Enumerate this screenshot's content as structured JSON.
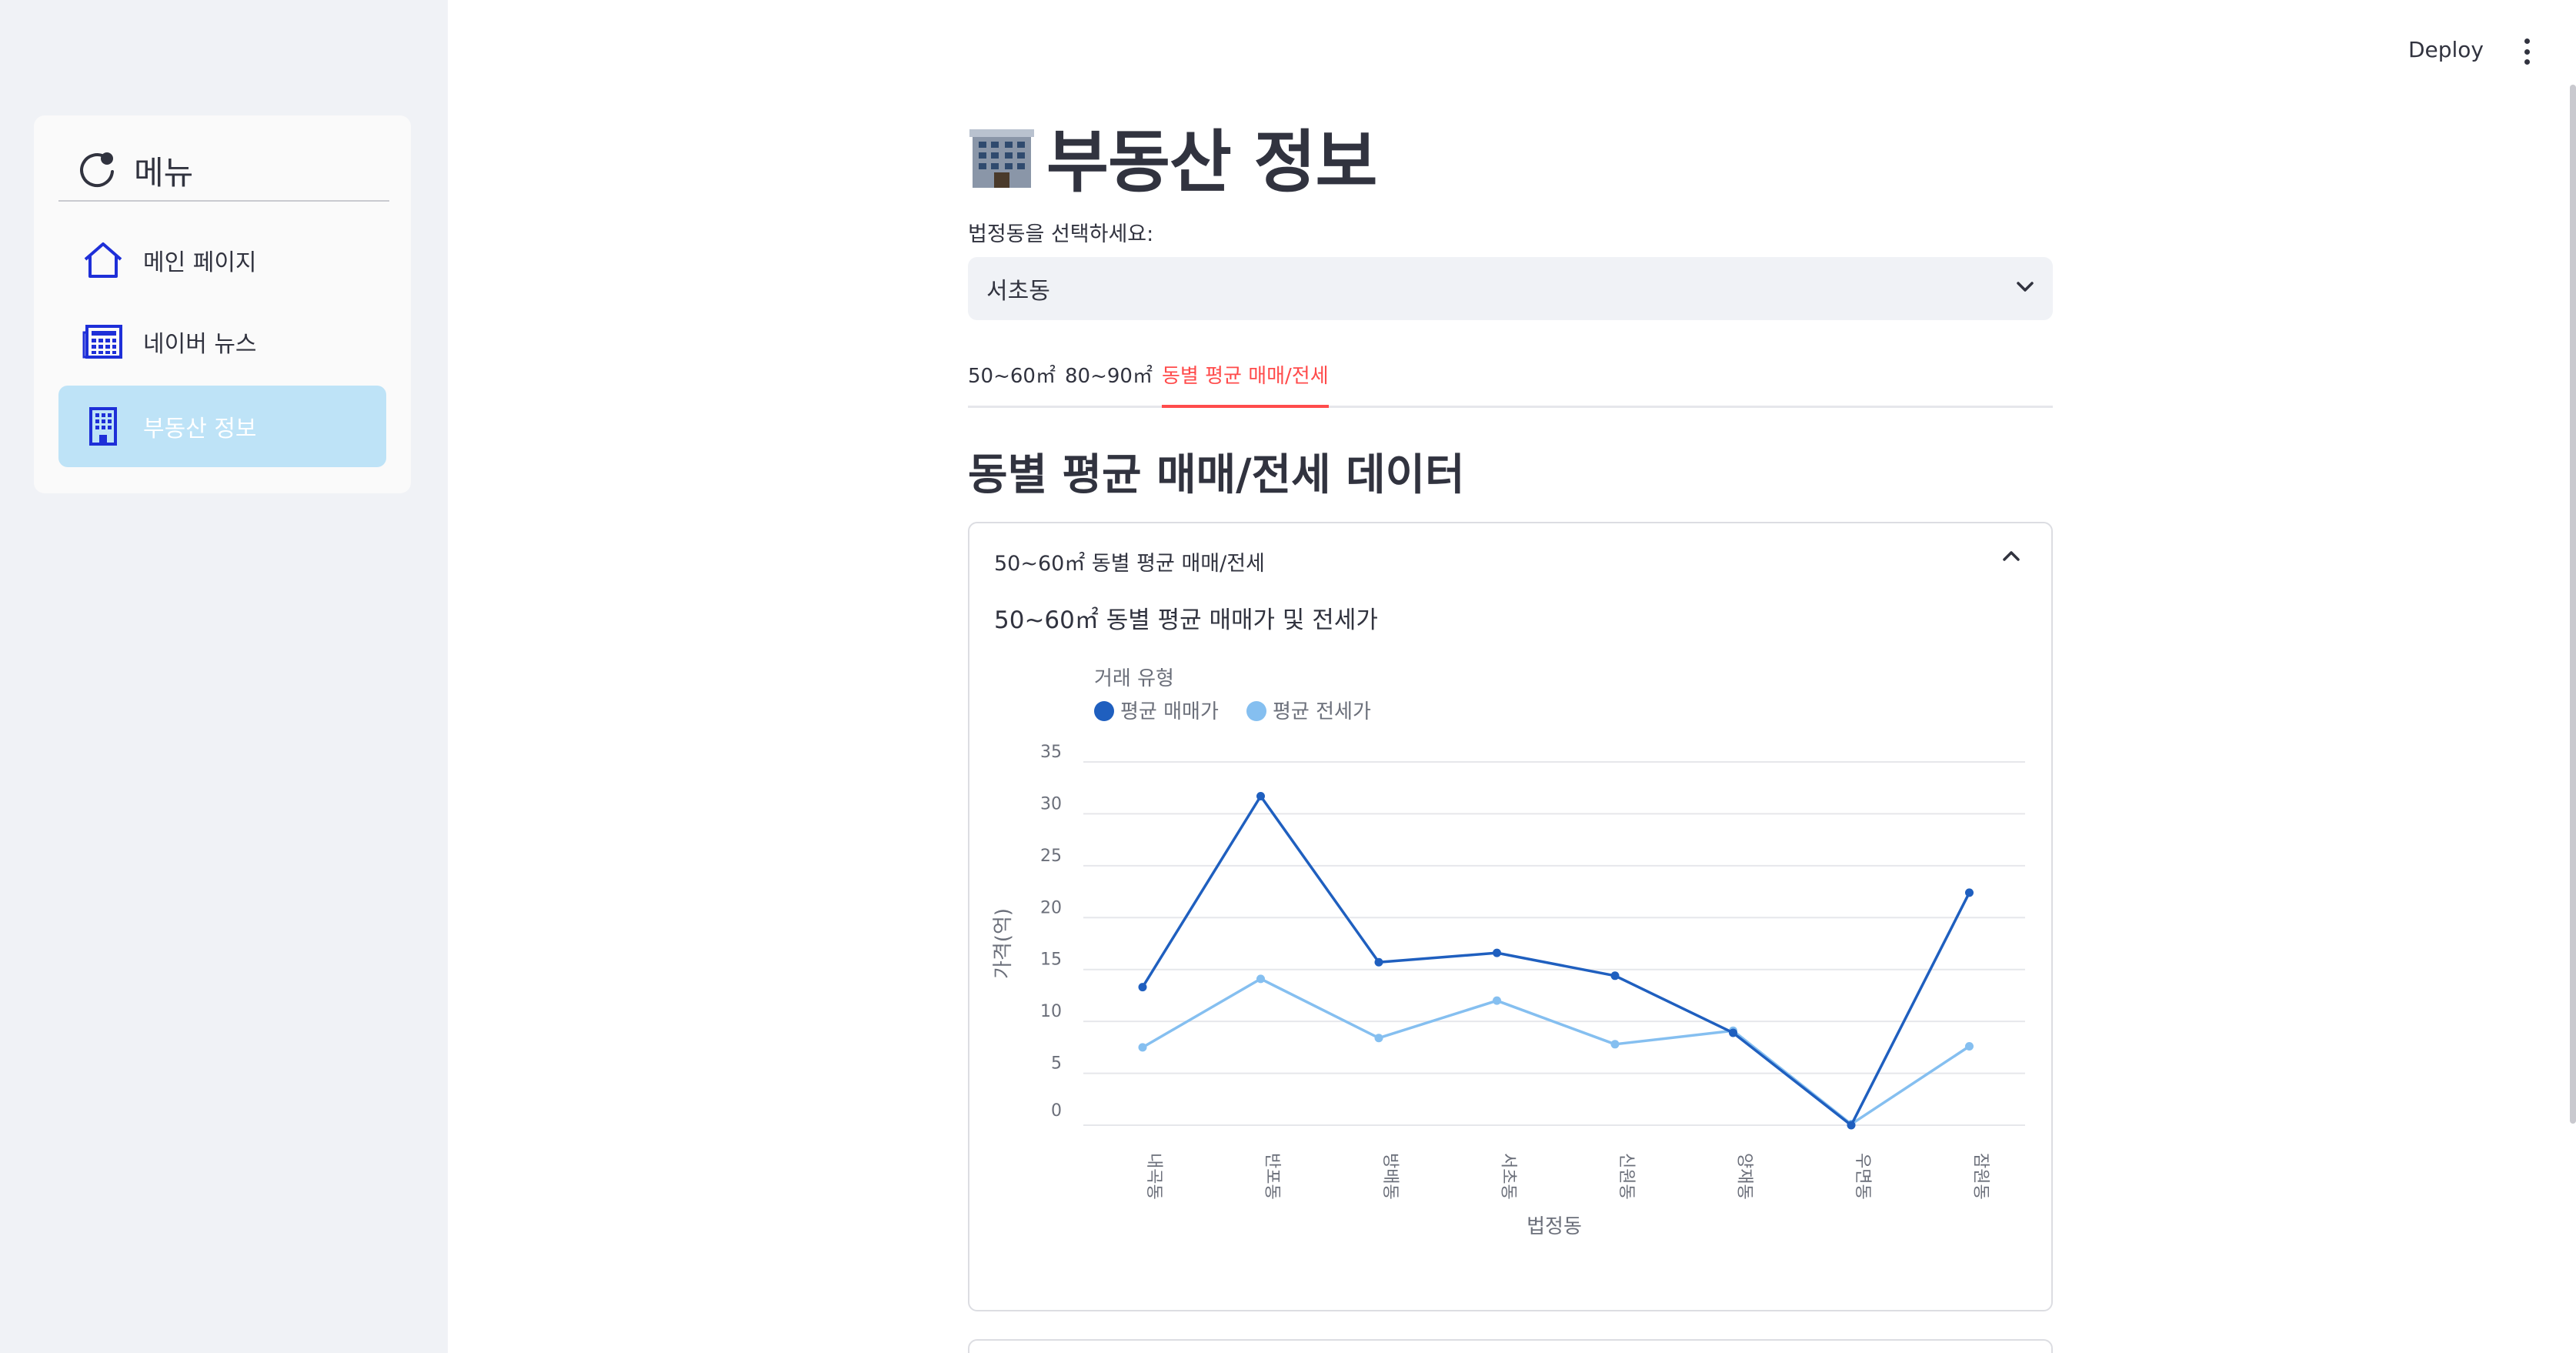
{
  "sidebar": {
    "menu_title": "메뉴",
    "items": [
      {
        "label": "메인 페이지",
        "icon": "house-icon"
      },
      {
        "label": "네이버 뉴스",
        "icon": "newspaper-icon"
      },
      {
        "label": "부동산 정보",
        "icon": "building-icon",
        "active": true
      }
    ]
  },
  "topbar": {
    "deploy_label": "Deploy"
  },
  "main": {
    "title": "부동산 정보",
    "select_label": "법정동을 선택하세요:",
    "select_value": "서초동",
    "tabs": [
      {
        "label": "50~60㎡"
      },
      {
        "label": "80~90㎡"
      },
      {
        "label": "동별 평균 매매/전세",
        "active": true
      }
    ],
    "section_title": "동별 평균 매매/전세 데이터",
    "expander_label": "50~60㎡ 동별 평균 매매/전세"
  },
  "colors": {
    "accent": "#ff4b4b",
    "series_sale": "#1f5fbf",
    "series_jeonse": "#85bff0",
    "sidebar_active": "#bee3f7"
  },
  "chart_data": {
    "type": "line",
    "title": "50~60㎡ 동별 평균 매매가 및 전세가",
    "legend_title": "거래 유형",
    "legend_position": "top-left",
    "xlabel": "법정동",
    "ylabel": "가격(억)",
    "categories": [
      "내곡동",
      "반포동",
      "방배동",
      "서초동",
      "신원동",
      "양재동",
      "우면동",
      "잠원동"
    ],
    "ylim": [
      0,
      35
    ],
    "yticks": [
      0,
      5,
      10,
      15,
      20,
      25,
      30,
      35
    ],
    "grid": true,
    "series": [
      {
        "name": "평균 매매가",
        "values": [
          13.3,
          31.7,
          15.7,
          16.6,
          14.4,
          8.9,
          0,
          22.4
        ]
      },
      {
        "name": "평균 전세가",
        "values": [
          7.5,
          14.1,
          8.4,
          12.0,
          7.8,
          9.1,
          0.1,
          7.6
        ]
      }
    ]
  }
}
